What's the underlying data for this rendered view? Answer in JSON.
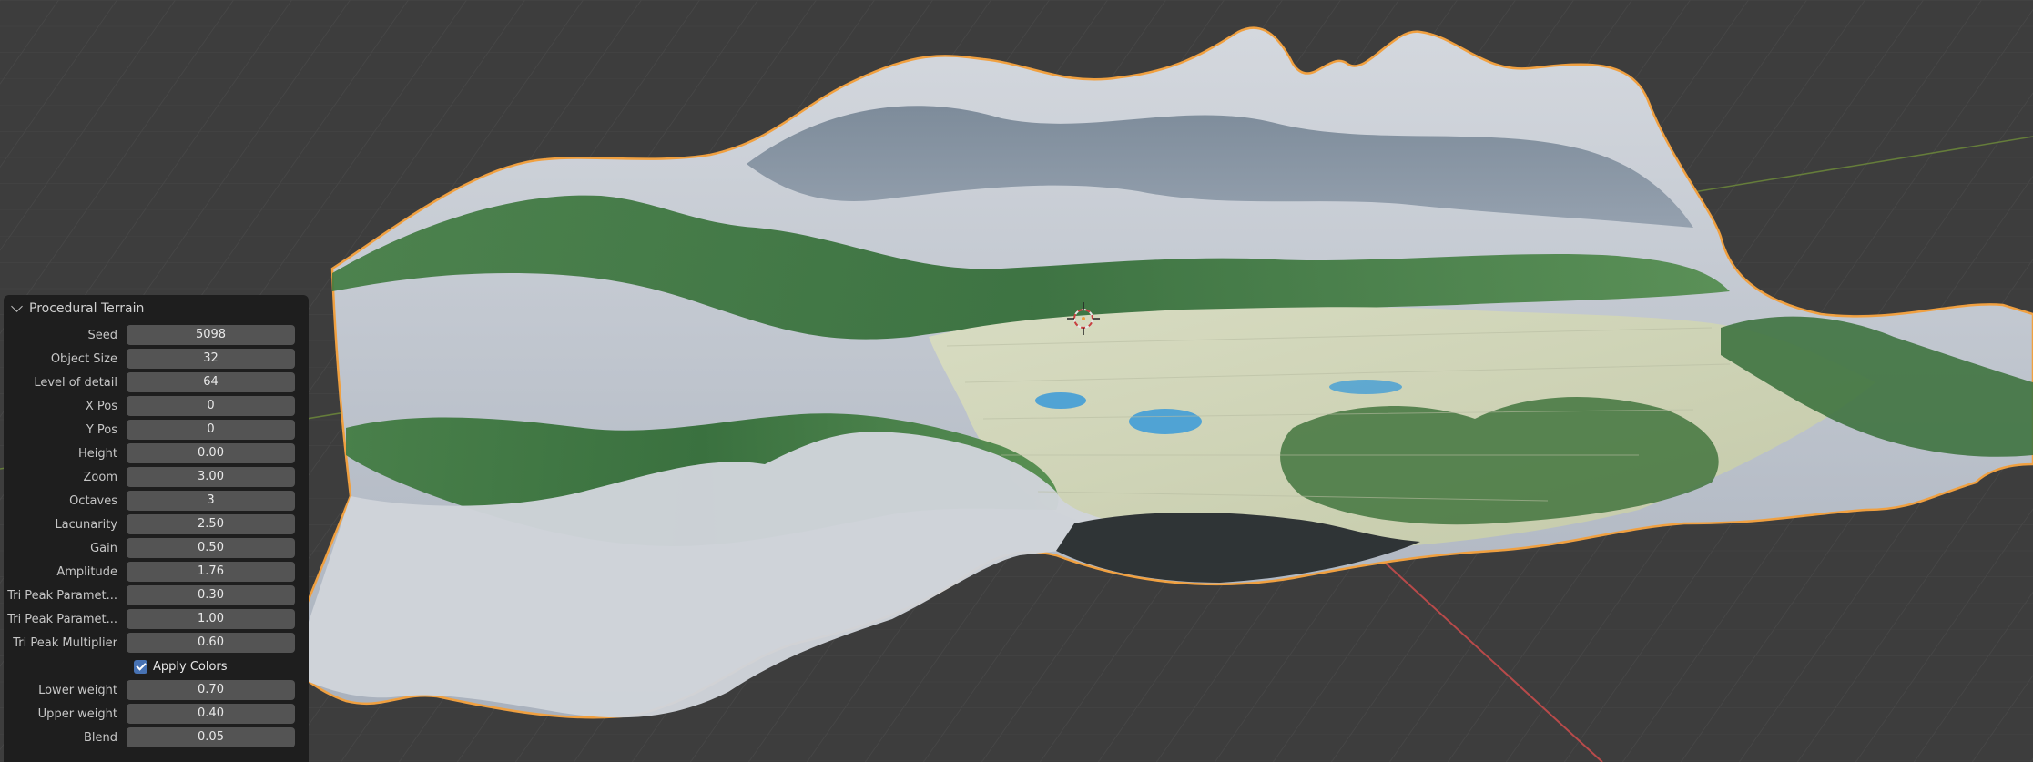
{
  "panel": {
    "title": "Procedural Terrain",
    "fields": [
      {
        "label": "Seed",
        "value": "5098"
      },
      {
        "label": "Object Size",
        "value": "32"
      },
      {
        "label": "Level of detail",
        "value": "64"
      },
      {
        "label": "X Pos",
        "value": "0"
      },
      {
        "label": "Y Pos",
        "value": "0"
      },
      {
        "label": "Height",
        "value": "0.00"
      },
      {
        "label": "Zoom",
        "value": "3.00"
      },
      {
        "label": "Octaves",
        "value": "3"
      },
      {
        "label": "Lacunarity",
        "value": "2.50"
      },
      {
        "label": "Gain",
        "value": "0.50"
      },
      {
        "label": "Amplitude",
        "value": "1.76"
      },
      {
        "label": "Tri Peak Paramet...",
        "value": "0.30"
      },
      {
        "label": "Tri Peak Paramet...",
        "value": "1.00"
      },
      {
        "label": "Tri Peak Multiplier",
        "value": "0.60"
      }
    ],
    "apply_colors": {
      "label": "Apply Colors",
      "checked": true
    },
    "fields2": [
      {
        "label": "Lower weight",
        "value": "0.70"
      },
      {
        "label": "Upper weight",
        "value": "0.40"
      },
      {
        "label": "Blend",
        "value": "0.05"
      }
    ]
  },
  "viewport": {
    "background_color": "#3d3d3d",
    "selection_outline_color": "#f0a040",
    "x_axis_color": "#b84a4a",
    "y_axis_color": "#7a9a3a"
  }
}
